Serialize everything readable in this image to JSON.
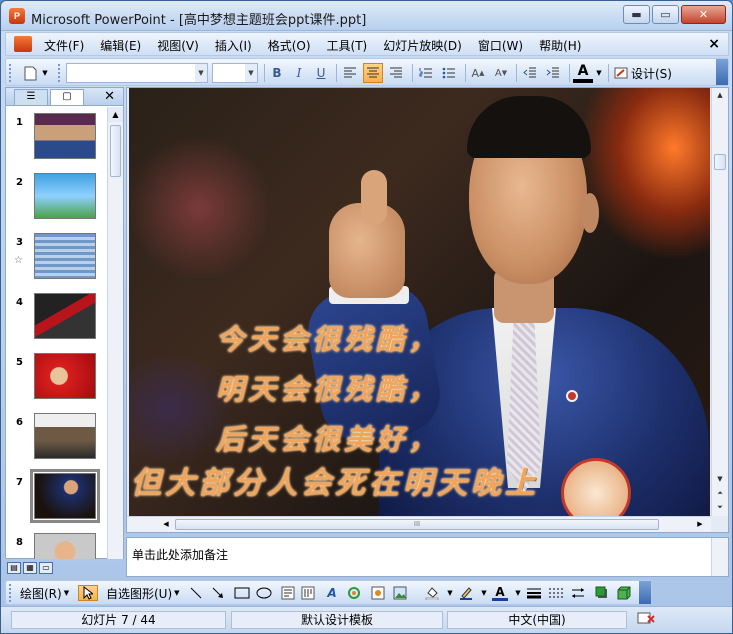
{
  "window": {
    "title": "Microsoft PowerPoint - [高中梦想主题班会ppt课件.ppt]",
    "app_icon": "P",
    "buttons": {
      "minimize": "▬",
      "maximize": "▭",
      "close": "✕"
    }
  },
  "menu": {
    "items": [
      {
        "label": "文件(F)"
      },
      {
        "label": "编辑(E)"
      },
      {
        "label": "视图(V)"
      },
      {
        "label": "插入(I)"
      },
      {
        "label": "格式(O)"
      },
      {
        "label": "工具(T)"
      },
      {
        "label": "幻灯片放映(D)"
      },
      {
        "label": "窗口(W)"
      },
      {
        "label": "帮助(H)"
      }
    ],
    "close_glyph": "×"
  },
  "toolbar": {
    "font_name": "",
    "font_size": "",
    "bold": "B",
    "italic": "I",
    "underline": "U",
    "font_color_glyph": "A",
    "design_label": "设计(S)"
  },
  "left_pane": {
    "close_glyph": "✕",
    "slides": [
      {
        "num": "1"
      },
      {
        "num": "2"
      },
      {
        "num": "3",
        "star": "☆"
      },
      {
        "num": "4"
      },
      {
        "num": "5"
      },
      {
        "num": "6"
      },
      {
        "num": "7",
        "selected": true
      },
      {
        "num": "8"
      }
    ]
  },
  "slide": {
    "poem": [
      "今天会很残酷，",
      "明天会很残酷，",
      "后天会很美好，",
      "但大部分人会死在明天晚上"
    ],
    "hscroll_grip": "III"
  },
  "notes": {
    "placeholder": "单击此处添加备注"
  },
  "draw_toolbar": {
    "draw_label": "绘图(R)",
    "autoshapes_label": "自选图形(U)"
  },
  "status": {
    "slide_info": "幻灯片 7 / 44",
    "template": "默认设计模板",
    "language": "中文(中国)"
  },
  "colors": {
    "accent_frame": "#3a5f8f",
    "toolbar_active": "#f7b14a",
    "poem_text": "#f0a45c"
  }
}
